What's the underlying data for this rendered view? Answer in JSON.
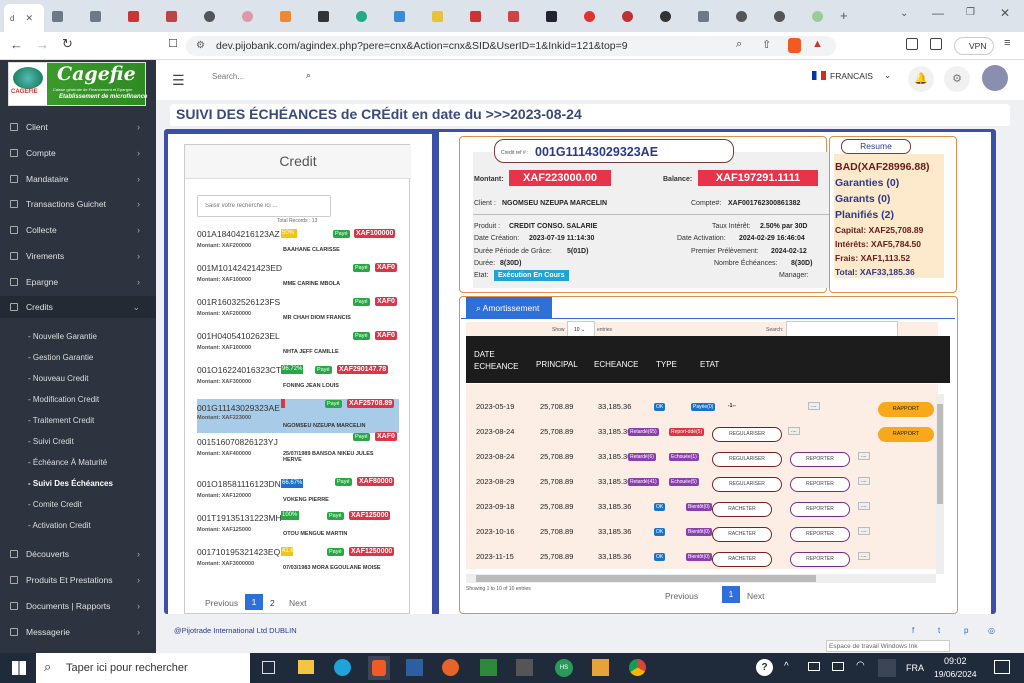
{
  "browser": {
    "active_tab_label": "d",
    "url": "dev.pijobank.com/agindex.php?pere=cnx&Action=cnx&SID&UserID=1&Inkid=121&top=9",
    "vpn_label": "VPN",
    "tab_hint": "Espace de travail Windows Ink"
  },
  "logo": {
    "word": "Cagefie",
    "tagline": "Caisse générale de Financement et Epargne",
    "sub": "Etablissement de microfinance"
  },
  "topnav": {
    "search_placeholder": "Search...",
    "language": "FRANCAIS"
  },
  "sidebar": {
    "items": [
      {
        "label": "Client"
      },
      {
        "label": "Compte"
      },
      {
        "label": "Mandataire"
      },
      {
        "label": "Transactions Guichet"
      },
      {
        "label": "Collecte"
      },
      {
        "label": "Virements"
      },
      {
        "label": "Epargne"
      },
      {
        "label": "Credits"
      }
    ],
    "sub_items": [
      {
        "label": "- Nouvelle Garantie"
      },
      {
        "label": "- Gestion Garantie"
      },
      {
        "label": "- Nouveau Credit"
      },
      {
        "label": "- Modification Credit"
      },
      {
        "label": "- Traitement Credit"
      },
      {
        "label": "- Suivi Credit"
      },
      {
        "label": "- Échéance À Maturité"
      },
      {
        "label": "- Suivi Des Échéances"
      },
      {
        "label": "- Comite Credit"
      },
      {
        "label": "- Activation Credit"
      }
    ],
    "bottom_items": [
      {
        "label": "Découverts"
      },
      {
        "label": "Produits Et Prestations"
      },
      {
        "label": "Documents | Rapports"
      },
      {
        "label": "Messagerie"
      }
    ]
  },
  "page": {
    "title": "SUIVI DES ÉCHÉANCES de CRÉdit en date du >>>2023-08-24"
  },
  "credit_panel": {
    "title": "Credit",
    "search_placeholder": "Saisir votre recherche ici ...",
    "total_records": "Total Records : 13",
    "rows": [
      {
        "ref": "001A18404216123AZ",
        "montant": "Montant: XAF200000",
        "name": "BAAHANE CLARISSE",
        "prog": "50%",
        "prog_color": "#f0c419",
        "paye": "Payé",
        "amount": "XAF100000"
      },
      {
        "ref": "001M10142421423ED",
        "montant": "Montant: XAF100000",
        "name": "MME CARINE MBOLA",
        "prog": "",
        "prog_color": "",
        "paye": "Payé",
        "amount": "XAF0"
      },
      {
        "ref": "001R16032526123FS",
        "montant": "Montant: XAF200000",
        "name": "MR CHAH DIOM FRANCIS",
        "prog": "",
        "prog_color": "",
        "paye": "Payé",
        "amount": "XAF0"
      },
      {
        "ref": "001H04054102623EL",
        "montant": "Montant: XAF100000",
        "name": "NHTA JEFF CAMILLE",
        "prog": "",
        "prog_color": "",
        "paye": "Payé",
        "amount": "XAF0"
      },
      {
        "ref": "001O16224016323CT",
        "montant": "Montant: XAF300000",
        "name": "FONING JEAN LOUIS",
        "prog": "96.72%",
        "prog_color": "#28a745",
        "paye": "Payé",
        "amount": "XAF290147.78"
      },
      {
        "ref": "001G11143029323AE",
        "montant": "Montant: XAF223000",
        "name": "NGOMSEU NZEUPA MARCELIN",
        "prog": "",
        "prog_color": "#dc3545",
        "paye": "Payé",
        "amount": "XAF25708.89"
      },
      {
        "ref": "001516070826123YJ",
        "montant": "Montant: XAF400000",
        "name": "25/07/1989 BANSOA NIKEU JULES HERVE",
        "prog": "",
        "prog_color": "",
        "paye": "Payé",
        "amount": "XAF0"
      },
      {
        "ref": "001O18581116123DN",
        "montant": "Montant: XAF120000",
        "name": "VOKENG PIERRE",
        "prog": "66.67%",
        "prog_color": "#1a73c8",
        "paye": "Payé",
        "amount": "XAF80000"
      },
      {
        "ref": "001T19135131223MH",
        "montant": "Montant: XAF125000",
        "name": "OTOU MENGUE MARTIN",
        "prog": "100%",
        "prog_color": "#28a745",
        "paye": "Payé",
        "amount": "XAF125000"
      },
      {
        "ref": "001710195321423EQ",
        "montant": "Montant: XAF3000000",
        "name": "07/03/1983 MORA EGOULANE MOISE",
        "prog": "41.6",
        "prog_color": "#f0c419",
        "paye": "Payé",
        "amount": "XAF1250000"
      }
    ],
    "pager": {
      "prev": "Previous",
      "p1": "1",
      "p2": "2",
      "next": "Next"
    }
  },
  "credit_detail": {
    "ref_label": "Credit ref # :",
    "ref": "001G11143029323AE",
    "montant_label": "Montant:",
    "montant": "XAF223000.00",
    "balance_label": "Balance:",
    "balance": "XAF197291.1111",
    "client_label": "Client :",
    "client": "NGOMSEU NZEUPA MARCELIN",
    "compte_label": "Compte#:",
    "compte": "XAF001762300861382",
    "produit_label": "Produit :",
    "produit": "CREDIT CONSO. SALARIE",
    "taux_label": "Taux Intérêt:",
    "taux": "2.50% par 30D",
    "creation_label": "Date Création:",
    "creation": "2023-07-19 11:14:30",
    "activation_label": "Date Activation:",
    "activation": "2024-02-29 16:46:04",
    "grace_label": "Durée Période de Grâce:",
    "grace": "5(01D)",
    "premier_label": "Premier Prélèvement:",
    "premier": "2024-02-12",
    "duree_label": "Durée:",
    "duree": "8(30D)",
    "nombre_label": "Nombre Échéances:",
    "nombre": "8(30D)",
    "etat_label": "Etat:",
    "etat": "Exécution En Cours",
    "manager_label": "Manager:"
  },
  "resume": {
    "title": "Resume",
    "bad": "BAD(XAF28996.88)",
    "garanties": "Garanties (0)",
    "garants": "Garants (0)",
    "planifies": "Planifiés (2)",
    "capital": "Capital: XAF25,708.89",
    "interets": "Intérêts: XAF5,784.50",
    "frais": "Frais: XAF1,113.52",
    "total": "Total: XAF33,185.36"
  },
  "amortissement": {
    "tab": "Amortissement",
    "show": "Show",
    "show_val": "10",
    "entries": "entries",
    "search": "Search:",
    "headers": {
      "date": "DATE ECHEANCE",
      "principal": "PRINCIPAL",
      "echeance": "ECHEANCE",
      "type": "TYPE",
      "etat": "ETAT"
    },
    "rows": [
      {
        "date": "2023-05-19",
        "principal": "25,708.89",
        "echeance": "33,185.36",
        "type": "OK",
        "type_color": "#1a73c8",
        "etat": "Payée(0)",
        "etat_color": "#1a73c8",
        "b1": "-1--",
        "b2": "",
        "b3": "....",
        "b4": "",
        "rap": "RAPPORT"
      },
      {
        "date": "2023-08-24",
        "principal": "25,708.89",
        "echeance": "33,185.36",
        "type": "Retardé(65)",
        "type_color": "#8a3fb0",
        "etat": "Report-ddé(5)",
        "etat_color": "#dc3545",
        "b1": "REGULARISER",
        "b2": "",
        "b3": "....",
        "b4": "",
        "rap": "RAPPORT"
      },
      {
        "date": "2023-08-24",
        "principal": "25,708.89",
        "echeance": "33,185.36",
        "type": "Retardé(6)",
        "type_color": "#8a3fb0",
        "etat": "Echouée(1)",
        "etat_color": "#8a3fb0",
        "b1": "REGULARISER",
        "b2": "REPORTER",
        "b3": "",
        "b4": "....",
        "rap": ""
      },
      {
        "date": "2023-08-29",
        "principal": "25,708.89",
        "echeance": "33,185.36",
        "type": "Retardé(41)",
        "type_color": "#8a3fb0",
        "etat": "Echouée(5)",
        "etat_color": "#8a3fb0",
        "b1": "REGULARISER",
        "b2": "REPORTER",
        "b3": "",
        "b4": "....",
        "rap": ""
      },
      {
        "date": "2023-09-18",
        "principal": "25,708.89",
        "echeance": "33,185.36",
        "type": "OK",
        "type_color": "#1a73c8",
        "etat": "Bientôt(0)",
        "etat_color": "#8a3fb0",
        "b1": "RACHETER",
        "b2": "REPORTER",
        "b3": "",
        "b4": "....",
        "rap": ""
      },
      {
        "date": "2023-10-16",
        "principal": "25,708.89",
        "echeance": "33,185.36",
        "type": "OK",
        "type_color": "#1a73c8",
        "etat": "Bientôt(0)",
        "etat_color": "#8a3fb0",
        "b1": "RACHETER",
        "b2": "REPORTER",
        "b3": "",
        "b4": "....",
        "rap": ""
      },
      {
        "date": "2023-11-15",
        "principal": "25,708.89",
        "echeance": "33,185.36",
        "type": "OK",
        "type_color": "#1a73c8",
        "etat": "Bientôt(0)",
        "etat_color": "#8a3fb0",
        "b1": "RACHETER",
        "b2": "REPORTER",
        "b3": "",
        "b4": "....",
        "rap": ""
      }
    ],
    "showing": "Showing 1 to 10 of 10 entries",
    "prev": "Previous",
    "page": "1",
    "next": "Next"
  },
  "footer": {
    "company": "@Pijotrade International Ltd DUBLIN"
  },
  "taskbar": {
    "search": "Taper ici pour rechercher",
    "lang": "FRA",
    "time": "09:02",
    "date": "19/06/2024"
  },
  "colors": {
    "sidebar": "#2d3440",
    "accent_blue": "#3b4fa8",
    "danger": "#dc3545",
    "success": "#28a745",
    "orange_border": "#e0904a"
  }
}
